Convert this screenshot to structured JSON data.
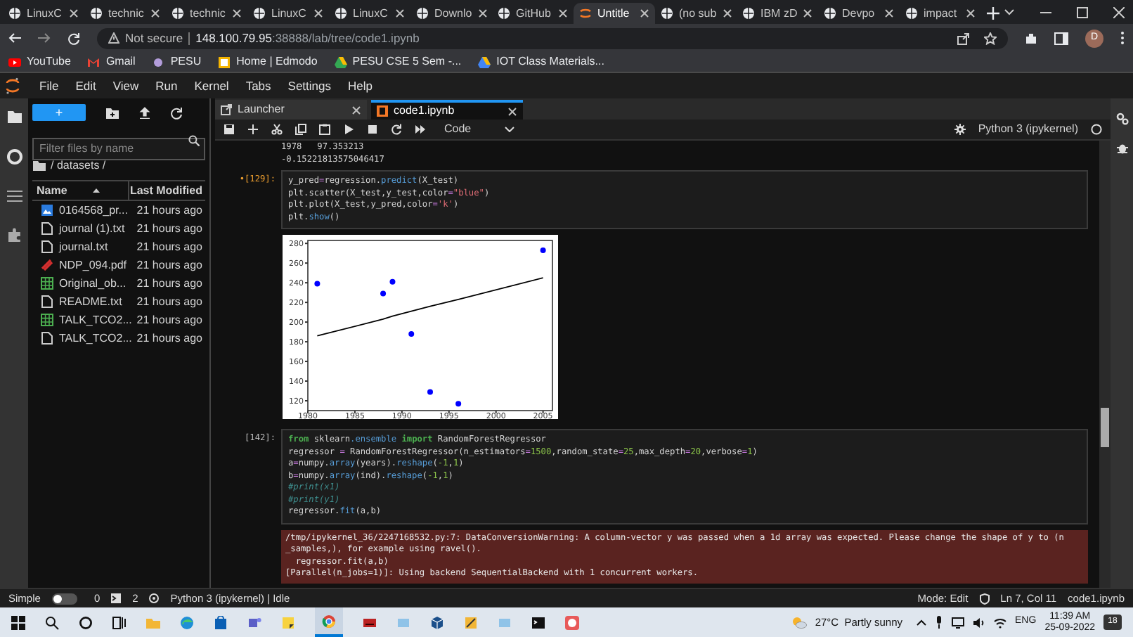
{
  "browser": {
    "tabs": [
      {
        "label": "LinuxC",
        "selected": false
      },
      {
        "label": "technic",
        "selected": false
      },
      {
        "label": "technic",
        "selected": false
      },
      {
        "label": "LinuxC",
        "selected": false
      },
      {
        "label": "LinuxC",
        "selected": false
      },
      {
        "label": "Downlo",
        "selected": false
      },
      {
        "label": "GitHub",
        "selected": false
      },
      {
        "label": "Untitle",
        "selected": true
      },
      {
        "label": "(no sub",
        "selected": false
      },
      {
        "label": "IBM zD",
        "selected": false
      },
      {
        "label": "Devpo",
        "selected": false
      },
      {
        "label": "impact",
        "selected": false
      }
    ],
    "security": "Not secure",
    "url_host": "148.100.79.95",
    "url_rest": ":38888/lab/tree/code1.ipynb",
    "profile_initial": "D",
    "bookmarks": [
      "YouTube",
      "Gmail",
      "PESU",
      "Home | Edmodo",
      "PESU CSE 5 Sem -...",
      "IOT Class Materials..."
    ]
  },
  "menu": [
    "File",
    "Edit",
    "View",
    "Run",
    "Kernel",
    "Tabs",
    "Settings",
    "Help"
  ],
  "file_browser": {
    "new_label": "+",
    "filter_placeholder": "Filter files by name",
    "path": "/ datasets /",
    "columns": [
      "Name",
      "Last Modified"
    ],
    "files": [
      {
        "name": "0164568_pr...",
        "modified": "21 hours ago",
        "kind": "image"
      },
      {
        "name": "journal (1).txt",
        "modified": "21 hours ago",
        "kind": "text"
      },
      {
        "name": "journal.txt",
        "modified": "21 hours ago",
        "kind": "text"
      },
      {
        "name": "NDP_094.pdf",
        "modified": "21 hours ago",
        "kind": "pdf"
      },
      {
        "name": "Original_ob...",
        "modified": "21 hours ago",
        "kind": "sheet"
      },
      {
        "name": "README.txt",
        "modified": "21 hours ago",
        "kind": "text"
      },
      {
        "name": "TALK_TCO2...",
        "modified": "21 hours ago",
        "kind": "sheet"
      },
      {
        "name": "TALK_TCO2...",
        "modified": "21 hours ago",
        "kind": "text"
      }
    ]
  },
  "doc_tabs": [
    {
      "label": "Launcher",
      "selected": false
    },
    {
      "label": "code1.ipynb",
      "selected": true
    }
  ],
  "toolbar": {
    "cell_type": "Code",
    "kernel": "Python 3 (ipykernel)"
  },
  "notebook": {
    "top_output": [
      "1978   97.353213",
      "-0.15221813575046417"
    ],
    "cells": [
      {
        "prompt": "•[129]:",
        "modified": true,
        "lines": [
          [
            {
              "text": "y_pred",
              "kind": "plain"
            },
            {
              "text": "=",
              "kind": "op"
            },
            {
              "text": "regression.",
              "kind": "plain"
            },
            {
              "text": "predict",
              "kind": "attr"
            },
            {
              "text": "(X_test)",
              "kind": "plain"
            }
          ],
          [
            {
              "text": "plt.",
              "kind": "plain"
            },
            {
              "text": "scatter",
              "kind": "plain"
            },
            {
              "text": "(X_test,y_test,color",
              "kind": "plain"
            },
            {
              "text": "=",
              "kind": "op"
            },
            {
              "text": "\"blue\"",
              "kind": "string"
            },
            {
              "text": ")",
              "kind": "plain"
            }
          ],
          [
            {
              "text": "plt.",
              "kind": "plain"
            },
            {
              "text": "plot",
              "kind": "plain"
            },
            {
              "text": "(X_test,y_pred,color",
              "kind": "plain"
            },
            {
              "text": "=",
              "kind": "op"
            },
            {
              "text": "'k'",
              "kind": "string"
            },
            {
              "text": ")",
              "kind": "plain"
            }
          ],
          [
            {
              "text": "plt.",
              "kind": "plain"
            },
            {
              "text": "show",
              "kind": "attr"
            },
            {
              "text": "()",
              "kind": "plain"
            }
          ]
        ],
        "chart_data": {
          "type": "scatter",
          "x": [
            1981,
            1988,
            1989,
            1991,
            1993,
            1996,
            2005
          ],
          "series": [
            {
              "type": "scatter",
              "color": "#0000ff",
              "values": [
                239,
                229,
                241,
                188,
                129,
                117,
                273
              ]
            },
            {
              "type": "line",
              "color": "#000000",
              "values": [
                186,
                203,
                206,
                211,
                216,
                223,
                245
              ]
            }
          ],
          "xlim": [
            1980,
            2006
          ],
          "ylim": [
            110,
            283
          ],
          "xticks": [
            1980,
            1985,
            1990,
            1995,
            2000,
            2005
          ],
          "yticks": [
            120,
            140,
            160,
            180,
            200,
            220,
            240,
            260,
            280
          ]
        }
      },
      {
        "prompt": "[142]:",
        "modified": false,
        "lines": [
          [
            {
              "text": "from",
              "kind": "keyword"
            },
            {
              "text": " sklearn",
              "kind": "plain"
            },
            {
              "text": ".ensemble",
              "kind": "attr"
            },
            {
              "text": " import",
              "kind": "keyword"
            },
            {
              "text": " RandomForestRegressor",
              "kind": "plain"
            }
          ],
          [
            {
              "text": "regressor ",
              "kind": "plain"
            },
            {
              "text": "=",
              "kind": "op"
            },
            {
              "text": " RandomForestRegressor(n_estimators",
              "kind": "plain"
            },
            {
              "text": "=",
              "kind": "op"
            },
            {
              "text": "1500",
              "kind": "number"
            },
            {
              "text": ",random_state",
              "kind": "plain"
            },
            {
              "text": "=",
              "kind": "op"
            },
            {
              "text": "25",
              "kind": "number"
            },
            {
              "text": ",max_depth",
              "kind": "plain"
            },
            {
              "text": "=",
              "kind": "op"
            },
            {
              "text": "20",
              "kind": "number"
            },
            {
              "text": ",verbose",
              "kind": "plain"
            },
            {
              "text": "=",
              "kind": "op"
            },
            {
              "text": "1",
              "kind": "number"
            },
            {
              "text": ")",
              "kind": "plain"
            }
          ],
          [
            {
              "text": "a",
              "kind": "plain"
            },
            {
              "text": "=",
              "kind": "op"
            },
            {
              "text": "numpy.",
              "kind": "plain"
            },
            {
              "text": "array",
              "kind": "attr"
            },
            {
              "text": "(years).",
              "kind": "plain"
            },
            {
              "text": "reshape",
              "kind": "attr"
            },
            {
              "text": "(",
              "kind": "plain"
            },
            {
              "text": "-1",
              "kind": "number"
            },
            {
              "text": ",",
              "kind": "plain"
            },
            {
              "text": "1",
              "kind": "number"
            },
            {
              "text": ")",
              "kind": "plain"
            }
          ],
          [
            {
              "text": "b",
              "kind": "plain"
            },
            {
              "text": "=",
              "kind": "op"
            },
            {
              "text": "numpy.",
              "kind": "plain"
            },
            {
              "text": "array",
              "kind": "attr"
            },
            {
              "text": "(ind).",
              "kind": "plain"
            },
            {
              "text": "reshape",
              "kind": "attr"
            },
            {
              "text": "(",
              "kind": "plain"
            },
            {
              "text": "-1",
              "kind": "number"
            },
            {
              "text": ",",
              "kind": "plain"
            },
            {
              "text": "1",
              "kind": "number"
            },
            {
              "text": ")",
              "kind": "plain"
            }
          ],
          [
            {
              "text": "#print(x1)",
              "kind": "comment"
            }
          ],
          [
            {
              "text": "#print(y1)",
              "kind": "comment"
            }
          ],
          [
            {
              "text": "regressor.",
              "kind": "plain"
            },
            {
              "text": "fit",
              "kind": "attr"
            },
            {
              "text": "(a,b)",
              "kind": "plain"
            }
          ]
        ],
        "stderr": [
          "/tmp/ipykernel_36/2247168532.py:7: DataConversionWarning: A column-vector y was passed when a 1d array was expected. Please change the shape of y to (n",
          "_samples,), for example using ravel().",
          "  regressor.fit(a,b)",
          "[Parallel(n_jobs=1)]: Using backend SequentialBackend with 1 concurrent workers."
        ]
      }
    ]
  },
  "status_bar": {
    "mode_label": "Simple",
    "simple_on": false,
    "terminals": "0",
    "kernels": "2",
    "kernel_status": "Python 3 (ipykernel) | Idle",
    "mode": "Mode: Edit",
    "position": "Ln 7, Col 11",
    "file": "code1.ipynb"
  },
  "taskbar": {
    "weather": "27°C  Partly sunny",
    "language": "ENG",
    "time": "11:39 AM",
    "date": "25-09-2022",
    "notifications": "18"
  }
}
